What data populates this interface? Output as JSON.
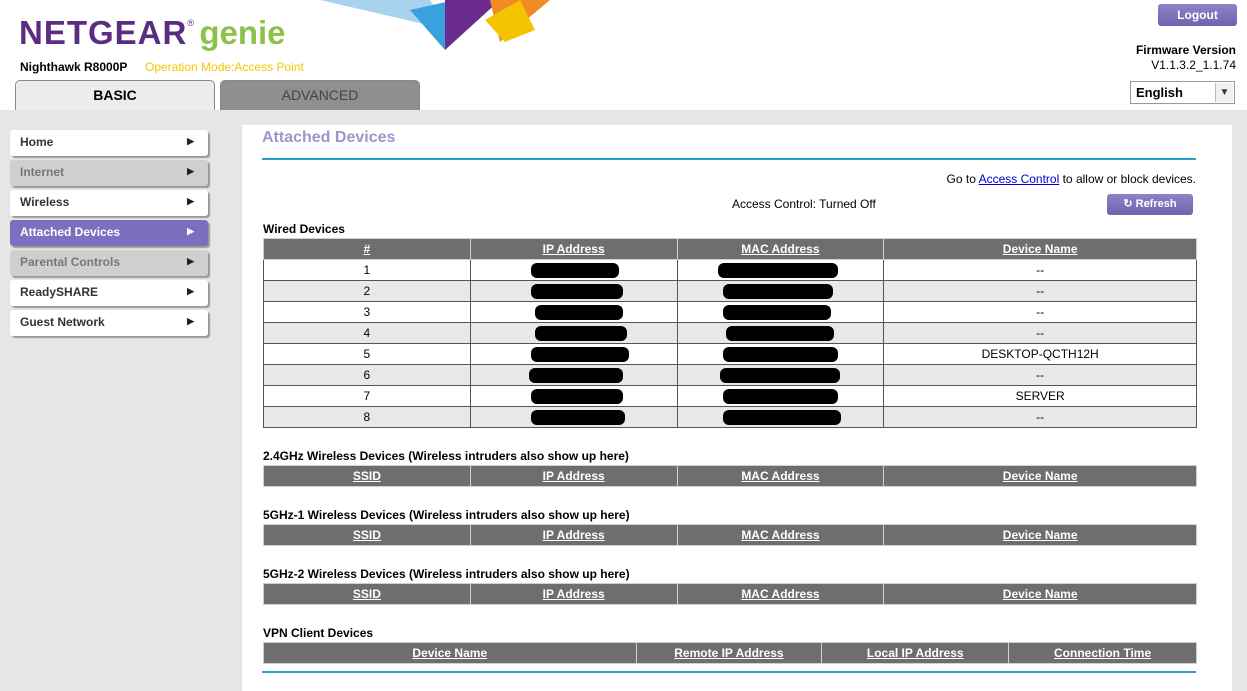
{
  "header": {
    "logo_brand": "NETGEAR",
    "logo_product": "genie",
    "model": "Nighthawk R8000P",
    "operation_mode": "Operation Mode:Access Point",
    "logout_label": "Logout",
    "firmware_label": "Firmware Version",
    "firmware_value": "V1.1.3.2_1.1.74",
    "language": "English",
    "tabs": [
      {
        "label": "BASIC"
      },
      {
        "label": "ADVANCED"
      }
    ]
  },
  "sidebar": {
    "items": [
      {
        "label": "Home"
      },
      {
        "label": "Internet"
      },
      {
        "label": "Wireless"
      },
      {
        "label": "Attached Devices"
      },
      {
        "label": "Parental Controls"
      },
      {
        "label": "ReadySHARE"
      },
      {
        "label": "Guest Network"
      }
    ]
  },
  "main": {
    "title": "Attached Devices",
    "goto_prefix": "Go to ",
    "goto_link": "Access Control",
    "goto_suffix": " to allow or block devices.",
    "access_control_status": "Access Control: Turned Off",
    "refresh_label": "Refresh",
    "wired": {
      "title": "Wired Devices",
      "headers": [
        "#",
        "IP Address",
        "MAC Address",
        "Device Name"
      ],
      "rows": [
        {
          "num": "1",
          "name": "--"
        },
        {
          "num": "2",
          "name": "--"
        },
        {
          "num": "3",
          "name": "--"
        },
        {
          "num": "4",
          "name": "--"
        },
        {
          "num": "5",
          "name": "DESKTOP-QCTH12H"
        },
        {
          "num": "6",
          "name": "--"
        },
        {
          "num": "7",
          "name": "SERVER"
        },
        {
          "num": "8",
          "name": "--"
        }
      ]
    },
    "wireless_24": {
      "title": "2.4GHz Wireless Devices (Wireless intruders also show up here)",
      "headers": [
        "SSID",
        "IP Address",
        "MAC Address",
        "Device Name"
      ]
    },
    "wireless_5_1": {
      "title": "5GHz-1 Wireless Devices (Wireless intruders also show up here)",
      "headers": [
        "SSID",
        "IP Address",
        "MAC Address",
        "Device Name"
      ]
    },
    "wireless_5_2": {
      "title": "5GHz-2 Wireless Devices (Wireless intruders also show up here)",
      "headers": [
        "SSID",
        "IP Address",
        "MAC Address",
        "Device Name"
      ]
    },
    "vpn": {
      "title": "VPN Client Devices",
      "headers": [
        "Device Name",
        "Remote IP Address",
        "Local IP Address",
        "Connection Time"
      ]
    }
  }
}
